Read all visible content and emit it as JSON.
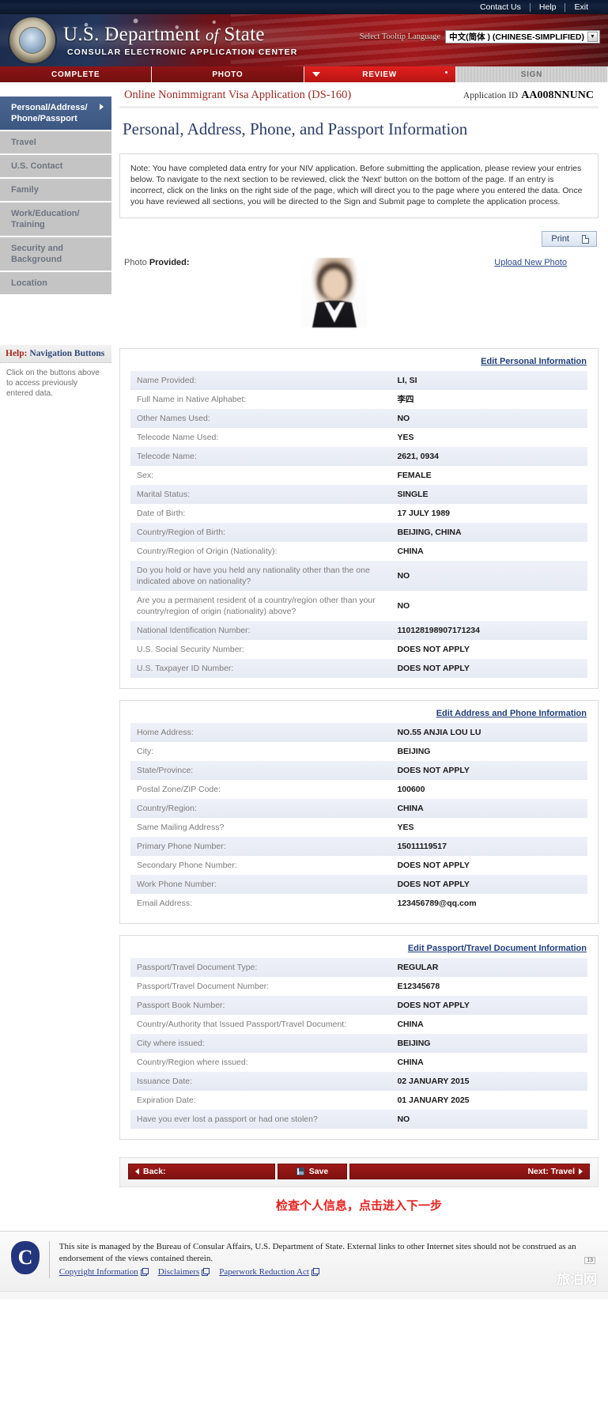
{
  "topbar": {
    "links": [
      "Contact Us",
      "Help",
      "Exit"
    ]
  },
  "banner": {
    "title_us": "U.S.",
    "title_department": "Department",
    "title_of": "of",
    "title_state": "State",
    "subtitle": "CONSULAR ELECTRONIC APPLICATION CENTER",
    "language_label": "Select Tooltip Language",
    "language_value": "中文(简体 ) (CHINESE-SIMPLIFIED)",
    "seal_icon": "us-department-of-state-seal"
  },
  "steps": [
    {
      "label": "COMPLETE",
      "state": "done"
    },
    {
      "label": "PHOTO",
      "state": "done"
    },
    {
      "label": "REVIEW",
      "state": "active"
    },
    {
      "label": "SIGN",
      "state": "todo"
    }
  ],
  "sidebar": {
    "items": [
      {
        "label": "Personal/Address/ Phone/Passport",
        "current": true
      },
      {
        "label": "Travel",
        "current": false
      },
      {
        "label": "U.S. Contact",
        "current": false
      },
      {
        "label": "Family",
        "current": false
      },
      {
        "label": "Work/Education/ Training",
        "current": false
      },
      {
        "label": "Security and Background",
        "current": false
      },
      {
        "label": "Location",
        "current": false
      }
    ],
    "help": {
      "heading_strong": "Help:",
      "heading_rest": " Navigation Buttons",
      "body": "Click on the buttons above to access previously entered data."
    }
  },
  "app": {
    "form_title": "Online Nonimmigrant Visa Application (DS-160)",
    "application_id_label": "Application ID",
    "application_id_value": "AA008NNUNC",
    "page_title": "Personal, Address, Phone, and Passport Information",
    "note": "Note: You have completed data entry for your NIV application. Before submitting the application, please review your entries below. To navigate to the next section to be reviewed, click the 'Next' button on the bottom of the page. If an entry is incorrect, click on the links on the right side of the page, which will direct you to the page where you entered the data. Once you have reviewed all sections, you will be directed to the Sign and Submit page to complete the application process.",
    "print_label": "Print",
    "photo_label_light": "Photo ",
    "photo_label_bold": "Provided:",
    "upload_link": "Upload New Photo"
  },
  "sections": [
    {
      "edit_link": "Edit Personal Information",
      "rows": [
        {
          "key": "Name Provided:",
          "value": "LI, SI"
        },
        {
          "key": "Full Name in Native Alphabet:",
          "value": "李四"
        },
        {
          "key": "Other Names Used:",
          "value": "NO"
        },
        {
          "key": "Telecode Name Used:",
          "value": "YES"
        },
        {
          "key": "Telecode Name:",
          "value": "2621, 0934"
        },
        {
          "key": "Sex:",
          "value": "FEMALE"
        },
        {
          "key": "Marital Status:",
          "value": "SINGLE"
        },
        {
          "key": "Date of Birth:",
          "value": "17 JULY 1989"
        },
        {
          "key": "Country/Region of Birth:",
          "value": "BEIJING, CHINA"
        },
        {
          "key": "Country/Region of Origin (Nationality):",
          "value": "CHINA"
        },
        {
          "key": "Do you hold or have you held any nationality other than the one indicated above on nationality?",
          "value": "NO"
        },
        {
          "key": "Are you a permanent resident of a country/region other than your country/region of origin (nationality) above?",
          "value": "NO"
        },
        {
          "key": "National Identification Number:",
          "value": "110128198907171234"
        },
        {
          "key": "U.S. Social Security Number:",
          "value": "DOES NOT APPLY"
        },
        {
          "key": "U.S. Taxpayer ID Number:",
          "value": "DOES NOT APPLY"
        }
      ]
    },
    {
      "edit_link": "Edit Address and Phone Information",
      "rows": [
        {
          "key": "Home Address:",
          "value": "NO.55 ANJIA LOU LU"
        },
        {
          "key": "City:",
          "value": "BEIJING"
        },
        {
          "key": "State/Province:",
          "value": "DOES NOT APPLY"
        },
        {
          "key": "Postal Zone/ZIP Code:",
          "value": "100600"
        },
        {
          "key": "Country/Region:",
          "value": "CHINA"
        },
        {
          "key": "Same Mailing Address?",
          "value": "YES"
        },
        {
          "key": "Primary Phone Number:",
          "value": "15011119517"
        },
        {
          "key": "Secondary Phone Number:",
          "value": "DOES NOT APPLY"
        },
        {
          "key": "Work Phone Number:",
          "value": "DOES NOT APPLY"
        },
        {
          "key": "Email Address:",
          "value": "123456789@qq.com"
        }
      ]
    },
    {
      "edit_link": "Edit Passport/Travel Document Information",
      "rows": [
        {
          "key": "Passport/Travel Document Type:",
          "value": "REGULAR"
        },
        {
          "key": "Passport/Travel Document Number:",
          "value": "E12345678"
        },
        {
          "key": "Passport Book Number:",
          "value": "DOES NOT APPLY"
        },
        {
          "key": "Country/Authority that Issued Passport/Travel Document:",
          "value": "CHINA"
        },
        {
          "key": "City where issued:",
          "value": "BEIJING"
        },
        {
          "key": "Country/Region where issued:",
          "value": "CHINA"
        },
        {
          "key": "Issuance Date:",
          "value": "02 JANUARY 2015"
        },
        {
          "key": "Expiration Date:",
          "value": "01 JANUARY 2025"
        },
        {
          "key": "Have you ever lost a passport or had one stolen?",
          "value": "NO"
        }
      ]
    }
  ],
  "navbuttons": {
    "back": "Back:",
    "save": "Save",
    "next": "Next: Travel"
  },
  "annotation": "检查个人信息，点击进入下一步",
  "footer": {
    "seal_letter": "C",
    "text": "This site is managed by the Bureau of Consular Affairs, U.S. Department of State. External links to other Internet sites should not be construed as an endorsement of the views contained therein.",
    "links": [
      "Copyright Information",
      "Disclaimers",
      "Paperwork Reduction Act"
    ],
    "page_number": "13",
    "watermark": "旅泊网"
  },
  "colors": {
    "brand_red": "#9e1a18",
    "active_step_red": "#e21f1d",
    "nav_blue": "#3c5782",
    "link_blue": "#1f3d7a",
    "annotation_red": "#e5231f"
  }
}
